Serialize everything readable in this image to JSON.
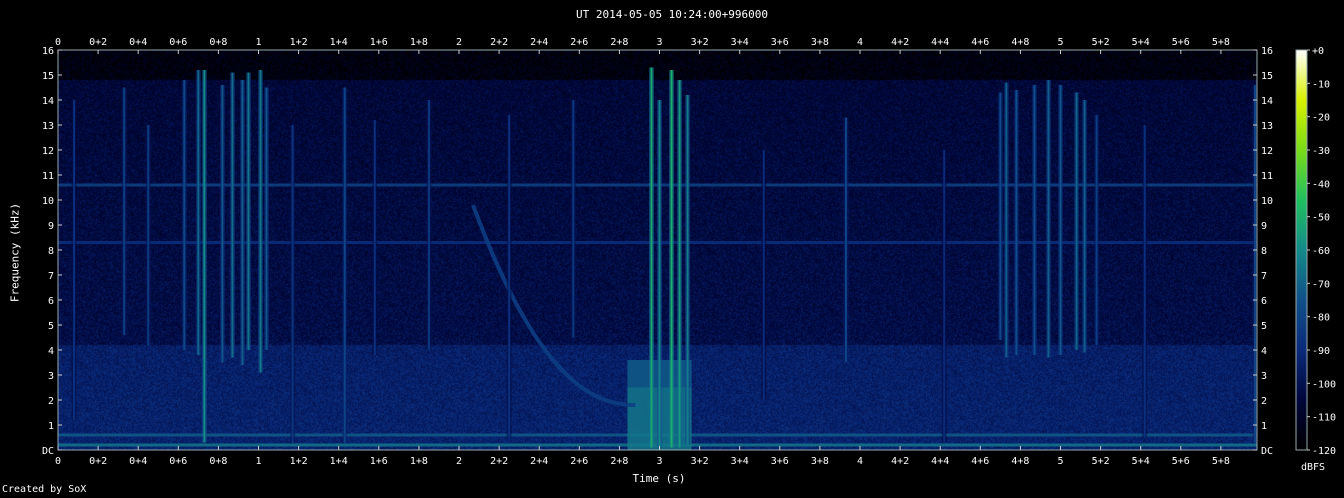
{
  "chart_data": {
    "type": "heatmap",
    "title": "UT 2014-05-05 10:24:00+996000",
    "xlabel": "Time (s)",
    "ylabel": "Frequency (kHz)",
    "colorbar_label": "dBFS",
    "credit": "Created by SoX",
    "x_ticks": [
      "0",
      "0+2",
      "0+4",
      "0+6",
      "0+8",
      "1",
      "1+2",
      "1+4",
      "1+6",
      "1+8",
      "2",
      "2+2",
      "2+4",
      "2+6",
      "2+8",
      "3",
      "3+2",
      "3+4",
      "3+6",
      "3+8",
      "4",
      "4+2",
      "4+4",
      "4+6",
      "4+8",
      "5",
      "5+2",
      "5+4",
      "5+6",
      "5+8"
    ],
    "y_ticks": [
      "DC",
      "1",
      "2",
      "3",
      "4",
      "5",
      "6",
      "7",
      "8",
      "9",
      "10",
      "11",
      "12",
      "13",
      "14",
      "15",
      "16"
    ],
    "colorbar_ticks": [
      "+0",
      "-10",
      "-20",
      "-30",
      "-40",
      "-50",
      "-60",
      "-70",
      "-80",
      "-90",
      "-100",
      "-110",
      "-120"
    ],
    "xlim": [
      0,
      5.98
    ],
    "ylim": [
      0,
      16
    ],
    "zlim": [
      -120,
      0
    ],
    "colormap": [
      "#000000",
      "#00063a",
      "#0a2a7a",
      "#10508a",
      "#148a8a",
      "#20c060",
      "#7adc18",
      "#d8f000",
      "#ffffff"
    ],
    "background_level_dbfs": -100,
    "features": {
      "hum_lines_khz": [
        {
          "freq": 10.6,
          "level": -80
        },
        {
          "freq": 8.3,
          "level": -88
        },
        {
          "freq": 0.6,
          "level": -72
        },
        {
          "freq": 0.2,
          "level": -65
        }
      ],
      "sferics": [
        {
          "t": 0.08,
          "fmin": 1.2,
          "fmax": 14.0,
          "level": -88
        },
        {
          "t": 0.33,
          "fmin": 4.6,
          "fmax": 14.5,
          "level": -82
        },
        {
          "t": 0.45,
          "fmin": 4.2,
          "fmax": 13.0,
          "level": -84
        },
        {
          "t": 0.63,
          "fmin": 4.0,
          "fmax": 14.8,
          "level": -78
        },
        {
          "t": 0.7,
          "fmin": 3.8,
          "fmax": 15.2,
          "level": -70
        },
        {
          "t": 0.73,
          "fmin": 0.3,
          "fmax": 15.2,
          "level": -60
        },
        {
          "t": 0.82,
          "fmin": 3.5,
          "fmax": 14.6,
          "level": -74
        },
        {
          "t": 0.87,
          "fmin": 3.7,
          "fmax": 15.1,
          "level": -68
        },
        {
          "t": 0.92,
          "fmin": 3.4,
          "fmax": 14.8,
          "level": -72
        },
        {
          "t": 0.95,
          "fmin": 4.0,
          "fmax": 15.1,
          "level": -66
        },
        {
          "t": 1.01,
          "fmin": 3.1,
          "fmax": 15.2,
          "level": -65
        },
        {
          "t": 1.04,
          "fmin": 4.0,
          "fmax": 14.5,
          "level": -74
        },
        {
          "t": 1.17,
          "fmin": 0.3,
          "fmax": 13.0,
          "level": -86
        },
        {
          "t": 1.43,
          "fmin": 0.3,
          "fmax": 14.5,
          "level": -80
        },
        {
          "t": 1.58,
          "fmin": 3.8,
          "fmax": 13.2,
          "level": -88
        },
        {
          "t": 1.85,
          "fmin": 4.0,
          "fmax": 14.0,
          "level": -85
        },
        {
          "t": 2.25,
          "fmin": 0.5,
          "fmax": 13.4,
          "level": -88
        },
        {
          "t": 2.57,
          "fmin": 4.5,
          "fmax": 14.0,
          "level": -85
        },
        {
          "t": 2.96,
          "fmin": 0.1,
          "fmax": 15.3,
          "level": -52
        },
        {
          "t": 3.0,
          "fmin": 0.1,
          "fmax": 14.0,
          "level": -62
        },
        {
          "t": 3.06,
          "fmin": 0.1,
          "fmax": 15.2,
          "level": -50
        },
        {
          "t": 3.1,
          "fmin": 0.1,
          "fmax": 14.8,
          "level": -56
        },
        {
          "t": 3.14,
          "fmin": 0.2,
          "fmax": 14.2,
          "level": -64
        },
        {
          "t": 3.52,
          "fmin": 2.0,
          "fmax": 12.0,
          "level": -90
        },
        {
          "t": 3.93,
          "fmin": 3.5,
          "fmax": 13.3,
          "level": -80
        },
        {
          "t": 4.42,
          "fmin": 0.3,
          "fmax": 12.0,
          "level": -90
        },
        {
          "t": 4.7,
          "fmin": 4.4,
          "fmax": 14.3,
          "level": -78
        },
        {
          "t": 4.73,
          "fmin": 3.7,
          "fmax": 14.7,
          "level": -72
        },
        {
          "t": 4.78,
          "fmin": 3.8,
          "fmax": 14.4,
          "level": -76
        },
        {
          "t": 4.87,
          "fmin": 3.8,
          "fmax": 14.6,
          "level": -76
        },
        {
          "t": 4.94,
          "fmin": 3.7,
          "fmax": 14.8,
          "level": -72
        },
        {
          "t": 5.0,
          "fmin": 3.8,
          "fmax": 14.6,
          "level": -74
        },
        {
          "t": 5.08,
          "fmin": 4.0,
          "fmax": 14.3,
          "level": -70
        },
        {
          "t": 5.12,
          "fmin": 3.9,
          "fmax": 14.0,
          "level": -72
        },
        {
          "t": 5.18,
          "fmin": 4.2,
          "fmax": 13.4,
          "level": -82
        },
        {
          "t": 5.42,
          "fmin": 0.5,
          "fmax": 13.0,
          "level": -88
        },
        {
          "t": 5.97,
          "fmin": 0.3,
          "fmax": 14.6,
          "level": -80
        }
      ],
      "whistler": {
        "t_start": 2.07,
        "f_start": 9.8,
        "t_end": 2.88,
        "f_end": 1.8,
        "level": -82
      },
      "bursts": [
        {
          "t_start": 2.84,
          "t_end": 3.16,
          "fmin": 0.0,
          "fmax": 2.5,
          "level": -65
        },
        {
          "t_start": 2.84,
          "t_end": 3.16,
          "fmin": 2.5,
          "fmax": 3.6,
          "level": -72
        }
      ],
      "noise_band": {
        "fmin": 0.0,
        "fmax": 4.2,
        "level": -92
      }
    }
  }
}
